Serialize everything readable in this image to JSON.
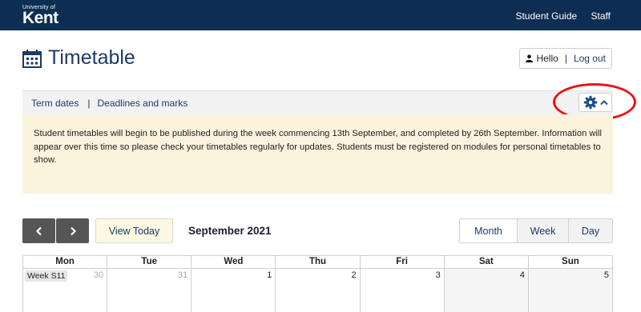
{
  "header": {
    "logo_small": "University of",
    "logo_big": "Kent",
    "links": [
      "Student Guide",
      "Staff"
    ]
  },
  "page": {
    "title": "Timetable",
    "calendar_icon": "calendar-icon"
  },
  "user": {
    "icon": "person-icon",
    "greeting": "Hello",
    "separator": "|",
    "logout": "Log out"
  },
  "linkbar": {
    "term_dates": "Term dates",
    "separator": "|",
    "deadlines": "Deadlines and marks",
    "settings_icon": "gear-icon",
    "toggle_icon": "chevron-up-icon"
  },
  "notice": {
    "text": "Student timetables will begin to be published during the week commencing 13th September, and completed by 26th September. Information will appear over this time so please check your timetables regularly for updates. Students must be registered on modules for personal timetables to show."
  },
  "toolbar": {
    "prev_icon": "chevron-left-icon",
    "next_icon": "chevron-right-icon",
    "today_label": "View Today",
    "current_month": "September 2021",
    "views": {
      "month": "Month",
      "week": "Week",
      "day": "Day"
    },
    "selected_view": "Month"
  },
  "calendar": {
    "weekdays": [
      "Mon",
      "Tue",
      "Wed",
      "Thu",
      "Fri",
      "Sat",
      "Sun"
    ],
    "week_label": "Week S11",
    "first_row": [
      "30",
      "31",
      "1",
      "2",
      "3",
      "4",
      "5"
    ]
  },
  "colors": {
    "header_bg": "#0e2d52",
    "accent": "#1c3a66",
    "notice_bg": "#fcf3dd",
    "highlight_ring": "#ee1111"
  }
}
